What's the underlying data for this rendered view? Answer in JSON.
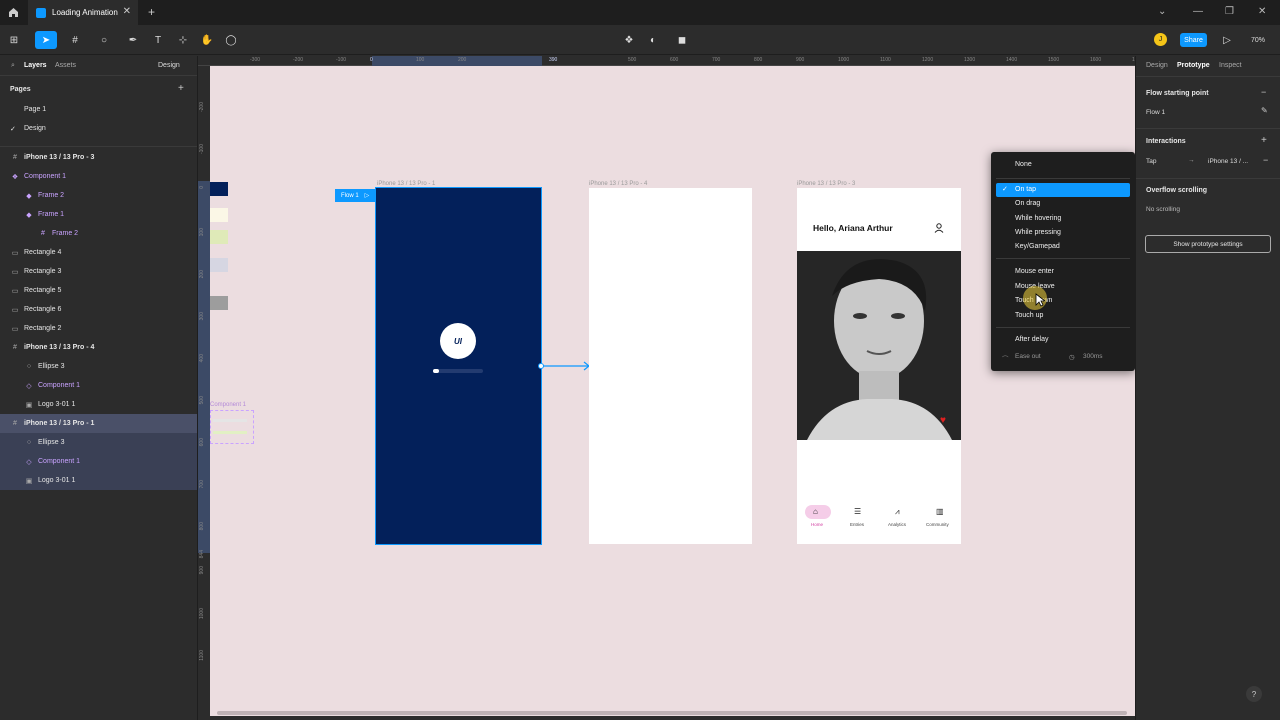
{
  "window": {
    "tab_title": "Loading Animation",
    "zoom": "70%",
    "share_label": "Share",
    "avatar_initial": "J"
  },
  "left_panel": {
    "tabs": {
      "layers": "Layers",
      "assets": "Assets",
      "design": "Design"
    },
    "pages_header": "Pages",
    "pages": [
      "Page 1",
      "Design"
    ],
    "layers": [
      {
        "label": "iPhone 13 / 13 Pro - 3",
        "icon": "#"
      },
      {
        "label": "Component 1",
        "icon": "❖"
      },
      {
        "label": "Frame 2",
        "icon": "◆"
      },
      {
        "label": "Frame 1",
        "icon": "◆"
      },
      {
        "label": "Frame 2",
        "icon": "#"
      },
      {
        "label": "Rectangle 4",
        "icon": "▭"
      },
      {
        "label": "Rectangle 3",
        "icon": "▭"
      },
      {
        "label": "Rectangle 5",
        "icon": "▭"
      },
      {
        "label": "Rectangle 6",
        "icon": "▭"
      },
      {
        "label": "Rectangle 2",
        "icon": "▭"
      },
      {
        "label": "iPhone 13 / 13 Pro - 4",
        "icon": "#"
      },
      {
        "label": "Ellipse 3",
        "icon": "○"
      },
      {
        "label": "Component 1",
        "icon": "◇"
      },
      {
        "label": "Logo 3-01 1",
        "icon": "▣"
      },
      {
        "label": "iPhone 13 / 13 Pro - 1",
        "icon": "#"
      },
      {
        "label": "Ellipse 3",
        "icon": "○"
      },
      {
        "label": "Component 1",
        "icon": "◇"
      },
      {
        "label": "Logo 3-01 1",
        "icon": "▣"
      }
    ]
  },
  "ruler": {
    "top": [
      "-300",
      "-200",
      "-100",
      "0",
      "100",
      "200",
      "390",
      "500",
      "600",
      "700",
      "800",
      "900",
      "1000",
      "1100",
      "1200",
      "1300",
      "1400",
      "1500",
      "1600",
      "1700"
    ],
    "left": [
      "-200",
      "-100",
      "0",
      "100",
      "200",
      "300",
      "400",
      "500",
      "600",
      "700",
      "800",
      "844",
      "900",
      "1000",
      "1100"
    ]
  },
  "canvas": {
    "frames": {
      "f1": "iPhone 13 / 13 Pro - 1",
      "f2": "iPhone 13 / 13 Pro - 4",
      "f3": "iPhone 13 / 13 Pro - 3"
    },
    "flow_tag": "Flow 1",
    "component_label": "Component 1",
    "logo_text": "UI",
    "loading_progress": 0.12,
    "profile": {
      "greeting": "Hello, Ariana Arthur",
      "nav": [
        "Home",
        "Entries",
        "Analytics",
        "Community"
      ]
    }
  },
  "dropdown": {
    "none": "None",
    "items_a": [
      "On tap",
      "On drag",
      "While hovering",
      "While pressing",
      "Key/Gamepad"
    ],
    "items_b": [
      "Mouse enter",
      "Mouse leave",
      "Touch down",
      "Touch up"
    ],
    "after_delay": "After delay",
    "ease": "Ease out",
    "duration": "300ms"
  },
  "right_panel": {
    "tabs": {
      "design": "Design",
      "prototype": "Prototype",
      "inspect": "Inspect"
    },
    "flow_header": "Flow starting point",
    "flow_name": "Flow 1",
    "interactions_header": "Interactions",
    "trigger": "Tap",
    "destination": "iPhone 13 / ...",
    "overflow_header": "Overflow scrolling",
    "overflow_value": "No scrolling",
    "proto_settings": "Show prototype settings"
  },
  "colors": {
    "accent": "#0d99ff",
    "frame_navy": "#03205a",
    "canvas_bg": "#ecdde0",
    "component_purple": "#c9a3ff"
  }
}
